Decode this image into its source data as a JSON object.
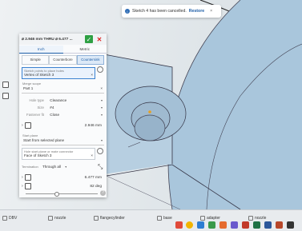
{
  "notification": {
    "message": "Sketch 4 has been cancelled.",
    "action": "Restore",
    "close": "×"
  },
  "dialog": {
    "title": "⌀ 2.946 mm THRU ⌀ 6.477 ...",
    "confirm": "✓",
    "cancel": "✕",
    "main_tabs": [
      "Inch",
      "Metric"
    ],
    "sub_tabs": [
      "Simple",
      "Counterbore",
      "Countersink"
    ],
    "sketch_points_label": "Sketch points to place holes",
    "sketch_points_value": "Vertex of Sketch 3",
    "merge_scope_label": "Merge scope",
    "merge_scope_value": "Part 1",
    "hole_type_label": "Hole type",
    "hole_type_value": "Clearance",
    "size_label": "Size",
    "size_value": "#4",
    "fastener_fit_label": "Fastener fit",
    "fastener_fit_value": "Close",
    "diameter_value": "2.946 mm",
    "start_plane_label": "Start plane",
    "start_plane_value": "Start from selected plane",
    "start_plane_face_label": "Hole start plane or mate connector",
    "start_plane_face_value": "Face of Sketch 3",
    "termination_label": "Termination",
    "termination_value": "Through all",
    "csk_diameter": "6.477 mm",
    "csk_angle": "82 deg",
    "help": "?"
  },
  "bottom_tabs": [
    "DBV",
    "nozzle",
    "flangecylinder",
    "base",
    "adapter",
    "nozzle"
  ],
  "colors": {
    "accent": "#1f5fa8",
    "ok_green": "#2ea043",
    "model_blue": "#a9c6dc"
  }
}
